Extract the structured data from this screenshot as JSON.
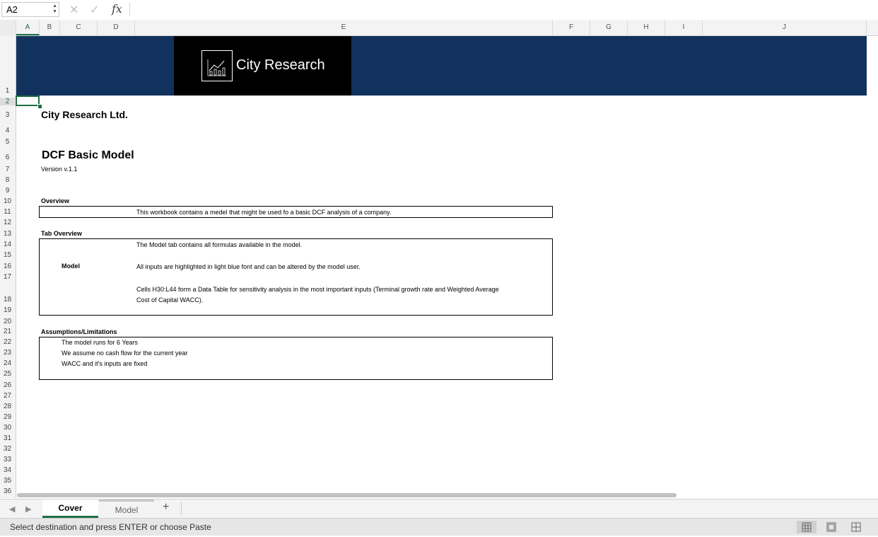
{
  "formula_bar": {
    "cell_ref": "A2",
    "fx": "fx",
    "icons": [
      "cancel-icon",
      "confirm-icon",
      "function-icon"
    ]
  },
  "columns": [
    "A",
    "B",
    "C",
    "D",
    "E",
    "F",
    "G",
    "H",
    "I",
    "J"
  ],
  "rows": [
    "1",
    "2",
    "3",
    "4",
    "5",
    "6",
    "7",
    "8",
    "9",
    "10",
    "11",
    "12",
    "13",
    "14",
    "15",
    "16",
    "17",
    "18",
    "19",
    "20",
    "21",
    "22",
    "23",
    "24",
    "25",
    "26",
    "27",
    "28",
    "29",
    "30",
    "31",
    "32",
    "33",
    "34",
    "35",
    "36"
  ],
  "selected_cell": "A2",
  "banner": {
    "logo_text": "City Research",
    "logo_icon": "chart-icon"
  },
  "sheet": {
    "company": "City Research Ltd.",
    "title": "DCF Basic Model",
    "version": "Version v.1.1",
    "overview": {
      "heading": "Overview",
      "text": "This workbook contains a medel that might be used fo a basic DCF analysis of a company."
    },
    "tab_overview": {
      "heading": "Tab Overview",
      "label": "Model",
      "line1": "The Model tab contains all formulas available in the model.",
      "line2": "All inputs are highlighted in light blue font and can be altered by the model user.",
      "line3a": "Cells H30:L44 form a Data Table for sensitivity analysis in the most important inputs (Terminal growth rate and Weighted Average",
      "line3b": "Cost of Capital WACC)."
    },
    "assumptions": {
      "heading": "Assumptions/Limitations",
      "items": [
        "The model runs for 6 Years",
        "We assume no cash flow for the current year",
        "WACC and it's inputs are fixed"
      ]
    }
  },
  "tabs": {
    "items": [
      "Cover",
      "Model"
    ],
    "active": "Cover",
    "add": "+"
  },
  "status": {
    "text": "Select destination and press ENTER or choose Paste"
  }
}
